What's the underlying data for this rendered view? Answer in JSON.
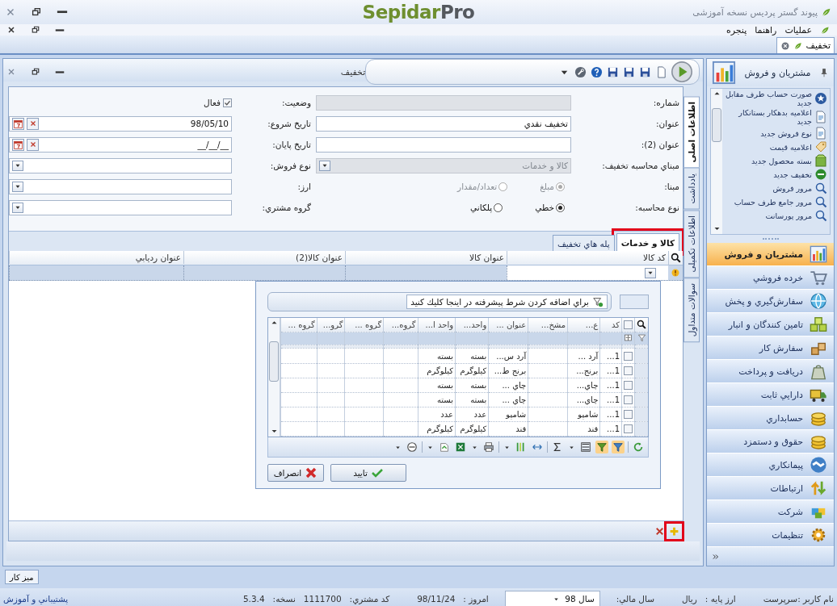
{
  "app": {
    "title": "پیوند گستر پردیس نسخه آموزشی",
    "logo_main": "Sepidar",
    "logo_accent": "Pro"
  },
  "menu": [
    "عملیات",
    "راهنما",
    "پنجره"
  ],
  "document_tabs": [
    {
      "label": "تخفیف",
      "selected": true
    }
  ],
  "form": {
    "title": "تخفیف",
    "side_tabs": [
      {
        "label": "اطلاعات اصلی",
        "selected": true
      },
      {
        "label": "یادداشت",
        "selected": false
      },
      {
        "label": "اطلاعات تکمیلی",
        "selected": false
      },
      {
        "label": "سوالات متداول",
        "selected": false
      }
    ],
    "fields_right": [
      {
        "kind": "text",
        "label": "شماره:",
        "disabled": true
      },
      {
        "kind": "text",
        "label": "عنوان:",
        "value": "تخفيف نقدي",
        "disabled": false
      },
      {
        "kind": "text",
        "label": "عنوان (2):",
        "disabled": false
      },
      {
        "kind": "select",
        "label": "مبناي محاسبه تخفيف:",
        "value": "كالا و خدمات",
        "disabled": true
      },
      {
        "kind": "radio",
        "label": "مبنا:",
        "disabled": true,
        "options": [
          {
            "label": "مبلغ",
            "selected": true
          },
          {
            "label": "تعداد/مقدار",
            "selected": false
          }
        ]
      },
      {
        "kind": "radio",
        "label": "نوع محاسبه:",
        "disabled": false,
        "options": [
          {
            "label": "خطي",
            "selected": true
          },
          {
            "label": "پلكاني",
            "selected": false
          }
        ]
      }
    ],
    "fields_left": [
      {
        "kind": "checkbox",
        "label": "وضعيت:",
        "text": "فعال",
        "checked": true
      },
      {
        "kind": "date",
        "label": "تاريخ شروع:",
        "value": "98/05/10"
      },
      {
        "kind": "date",
        "label": "تاريخ پايان:",
        "value": "__/__/__"
      },
      {
        "kind": "select",
        "label": "نوع فروش:",
        "disabled": false
      },
      {
        "kind": "select",
        "label": "ارز:",
        "disabled": false
      },
      {
        "kind": "select",
        "label": "گروه مشتري:",
        "disabled": false
      }
    ],
    "sub_tabs": [
      {
        "label": "كالا و خدمات",
        "selected": true,
        "highlighted": true
      },
      {
        "label": "پله هاي تخفيف",
        "selected": false,
        "highlighted": false
      }
    ],
    "grid": {
      "columns": [
        "كد كالا",
        "عنوان كالا",
        "عنوان كالا(2)",
        "عنوان رديابي"
      ]
    },
    "picker": {
      "filter_hint": "براي اضافه كردن شرط پيشرفته در اينجا كليك كنيد",
      "select_all": false,
      "columns": [
        "كد",
        "ع...",
        "مشخ...",
        "عنوان ...",
        "واحد...",
        "واحد ا...",
        "گروه...",
        "گروه ...",
        "گرو...",
        "گروه ..."
      ],
      "rows": [
        {
          "checked": false,
          "cells": [
            "1...",
            "آرد ...",
            "",
            "آرد س...",
            "بسته",
            "بسته"
          ]
        },
        {
          "checked": false,
          "cells": [
            "1...",
            "برنج...",
            "",
            "برنج ط...",
            "كيلوگرم",
            "كيلوگرم"
          ]
        },
        {
          "checked": false,
          "cells": [
            "1...",
            "چاي...",
            "",
            "چاي ...",
            "بسته",
            "بسته"
          ]
        },
        {
          "checked": false,
          "cells": [
            "1...",
            "چاي...",
            "",
            "چاي ...",
            "بسته",
            "بسته"
          ]
        },
        {
          "checked": false,
          "cells": [
            "1...",
            "شامپو",
            "",
            "شامپو",
            "عدد",
            "عدد"
          ]
        },
        {
          "checked": false,
          "cells": [
            "1...",
            "قند",
            "",
            "قند",
            "كيلوگرم",
            "كيلوگرم"
          ]
        }
      ],
      "buttons": [
        {
          "kind": "ok",
          "label": "تاييد"
        },
        {
          "kind": "cancel",
          "label": "انصراف"
        }
      ]
    },
    "footer": {
      "add_highlighted": true
    }
  },
  "sidebar": {
    "title": "مشتريان و فروش",
    "tasks": [
      "صورت حساب طرف مقابل جديد",
      "اعلاميه بدهكار بستانكار جديد",
      "نوع فروش جديد",
      "اعلاميه قيمت",
      "بسته محصول جديد",
      "تخفيف جديد",
      "مرور فروش",
      "مرور جامع طرف حساب",
      "مرور پورسانت"
    ],
    "nav": [
      {
        "label": "مشتريان و فروش",
        "selected": true
      },
      {
        "label": "خرده فروشي",
        "selected": false
      },
      {
        "label": "سفارش‌گيري و پخش",
        "selected": false
      },
      {
        "label": "تامين كنندگان و انبار",
        "selected": false
      },
      {
        "label": "سفارش كار",
        "selected": false
      },
      {
        "label": "دريافت و پرداخت",
        "selected": false
      },
      {
        "label": "دارايي ثابت",
        "selected": false
      },
      {
        "label": "حسابداري",
        "selected": false
      },
      {
        "label": "حقوق و دستمزد",
        "selected": false
      },
      {
        "label": "پيمانكاري",
        "selected": false
      },
      {
        "label": "ارتباطات",
        "selected": false
      },
      {
        "label": "شركت",
        "selected": false
      },
      {
        "label": "تنظيمات",
        "selected": false
      }
    ]
  },
  "desktop_button": "ميز كار",
  "status_bar": {
    "user": "نام كاربر :سرپرست",
    "base_currency_label": "ارز پايه :",
    "base_currency": "ريال",
    "fiscal_year_label": "سال مالي:",
    "fiscal_year": "سال 98",
    "today_label": "امروز :",
    "today": "98/11/24",
    "customer_code_label": "كد مشتري:",
    "customer_code": "1111700",
    "version_label": "نسخه:",
    "version": "5.3.4",
    "support_link": "پشتيباني و آموزش"
  }
}
